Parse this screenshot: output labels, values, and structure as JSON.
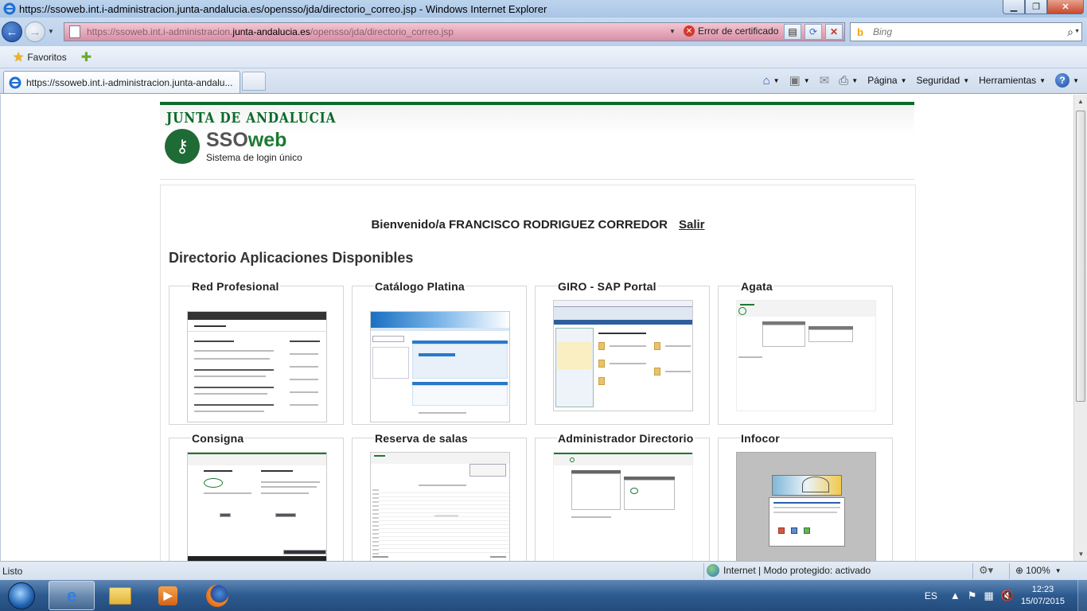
{
  "window": {
    "title": "https://ssoweb.int.i-administracion.junta-andalucia.es/opensso/jda/directorio_correo.jsp - Windows Internet Explorer"
  },
  "address": {
    "url_prefix": "https://ssoweb.int.i-administracion.",
    "url_domain": "junta-andalucia.es",
    "url_suffix": "/opensso/jda/directorio_correo.jsp",
    "cert_error": "Error de certificado"
  },
  "search": {
    "placeholder": "Bing"
  },
  "favorites": {
    "label": "Favoritos"
  },
  "tab": {
    "title": "https://ssoweb.int.i-administracion.junta-andalu..."
  },
  "commands": {
    "page": "Página",
    "security": "Seguridad",
    "tools": "Herramientas"
  },
  "site": {
    "brand": "JUNTA DE ANDALUCIA",
    "app_name_a": "SSO",
    "app_name_b": "web",
    "subtitle": "Sistema de login único",
    "welcome": "Bienvenido/a FRANCISCO RODRIGUEZ CORREDOR",
    "logout": "Salir",
    "directory_title": "Directorio Aplicaciones Disponibles",
    "apps": [
      {
        "name": "Red Profesional"
      },
      {
        "name": "Catálogo Platina"
      },
      {
        "name": "GIRO - SAP Portal"
      },
      {
        "name": "Agata"
      },
      {
        "name": "Consigna"
      },
      {
        "name": "Reserva de salas"
      },
      {
        "name": "Administrador Directorio"
      },
      {
        "name": "Infocor"
      }
    ]
  },
  "status": {
    "left": "Listo",
    "zone": "Internet | Modo protegido: activado",
    "zoom": "100%"
  },
  "taskbar": {
    "lang": "ES",
    "time": "12:23",
    "date": "15/07/2015"
  }
}
